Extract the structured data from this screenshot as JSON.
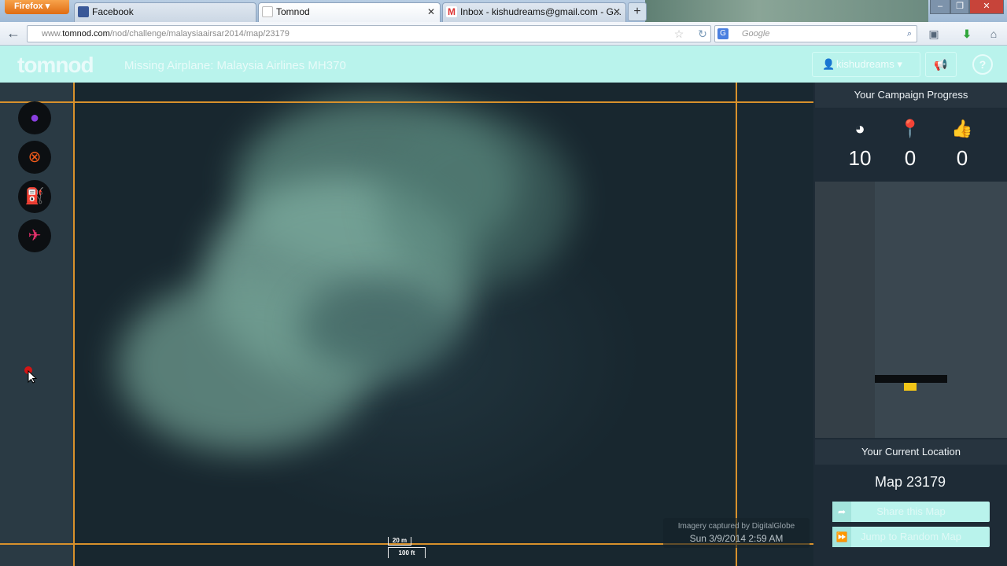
{
  "browser": {
    "menu_button": "Firefox",
    "tabs": [
      {
        "label": "Facebook",
        "icon": "facebook-icon"
      },
      {
        "label": "Tomnod",
        "icon": "blank-page-icon"
      },
      {
        "label": "Inbox - kishudreams@gmail.com - G...",
        "icon": "gmail-icon"
      }
    ],
    "url_prefix": "www.",
    "url_domain": "tomnod.com",
    "url_path": "/nod/challenge/malaysiaairsar2014/map/23179",
    "search_engine": "G",
    "search_placeholder": "Google"
  },
  "header": {
    "logo": "tomnod",
    "title": "Missing Airplane: Malaysia Airlines MH370",
    "username": "kishudreams",
    "help_label": "?"
  },
  "map": {
    "tools": [
      {
        "name": "tag-tool-pin",
        "icon": "map-pin-icon",
        "glyph": "●",
        "color": "#8a3fe0"
      },
      {
        "name": "tag-tool-wreckage",
        "icon": "close-circle-icon",
        "glyph": "⊗",
        "color": "#f05a1a"
      },
      {
        "name": "tag-tool-oil-slick",
        "icon": "fuel-pump-icon",
        "glyph": "⛽",
        "color": "#f2d21c"
      },
      {
        "name": "tag-tool-life-raft",
        "icon": "airplane-crossed-icon",
        "glyph": "✈",
        "color": "#e0306a"
      }
    ],
    "credit_line": "Imagery captured by DigitalGlobe",
    "credit_date": "Sun 3/9/2014 2:59 AM",
    "scale_metric": "20 m",
    "scale_imperial": "100 ft"
  },
  "panel": {
    "progress_title": "Your Campaign Progress",
    "stats": [
      {
        "icon": "globe-icon",
        "glyph": "◕",
        "value": "10"
      },
      {
        "icon": "map-pin-icon",
        "glyph": "⬤",
        "value": "0"
      },
      {
        "icon": "thumbs-up-icon",
        "glyph": "👍",
        "value": "0"
      }
    ],
    "location_title": "Your Current Location",
    "location_value": "Map 23179",
    "share_label": "Share this Map",
    "random_label": "Jump to Random Map"
  }
}
